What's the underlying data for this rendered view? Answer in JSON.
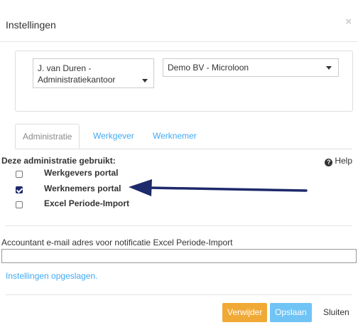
{
  "dialog": {
    "title": "Instellingen",
    "close_glyph": "×"
  },
  "selects": {
    "office_line1": "J. van Duren -",
    "office_line2": "Administratiekantoor",
    "company": "Demo BV - Microloon"
  },
  "tabs": [
    {
      "label": "Administratie",
      "active": true
    },
    {
      "label": "Werkgever",
      "active": false
    },
    {
      "label": "Werknemer",
      "active": false
    }
  ],
  "administration": {
    "section_title": "Deze administratie gebruikt:",
    "help_label": "Help",
    "options": [
      {
        "label": "Werkgevers portal",
        "checked": false
      },
      {
        "label": "Werknemers portal",
        "checked": true
      },
      {
        "label": "Excel Periode-Import",
        "checked": false
      }
    ]
  },
  "email": {
    "label": "Accountant e-mail adres voor notificatie Excel Periode-Import",
    "value": "",
    "placeholder": ""
  },
  "status_message": "Instellingen opgeslagen.",
  "footer": {
    "delete_label": "Verwijder",
    "save_label": "Opslaan",
    "close_label": "Sluiten"
  },
  "colors": {
    "link": "#3fa9f5",
    "delete": "#f0a020",
    "save": "#6fc3f5",
    "arrow": "#1d2a6b"
  },
  "icons": [
    "close-icon",
    "caret-down-icon",
    "help-icon",
    "arrow-annotation"
  ]
}
